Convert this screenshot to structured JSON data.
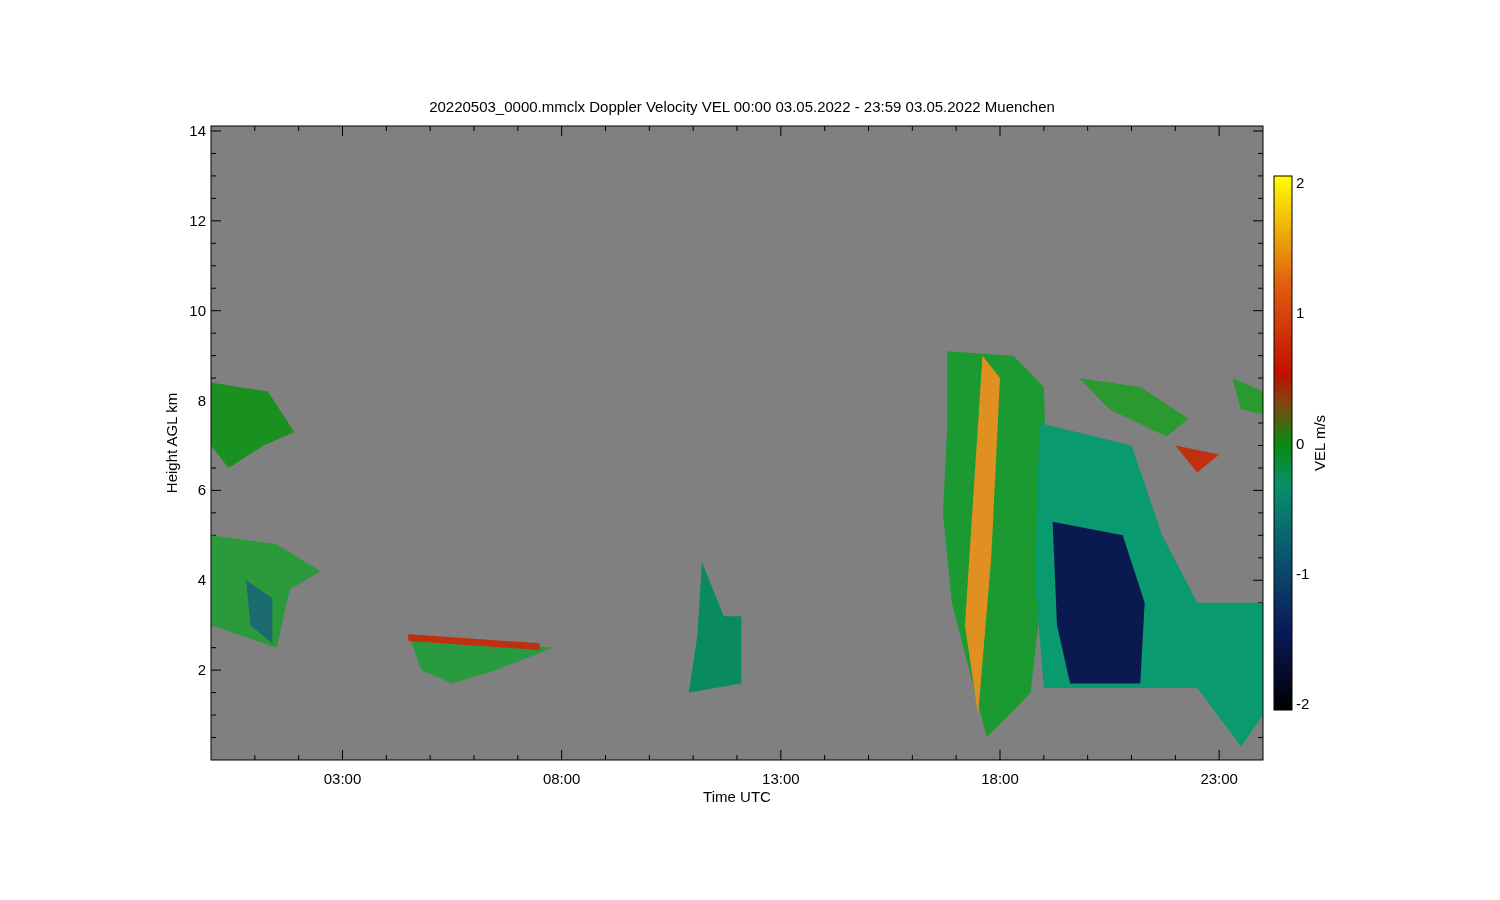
{
  "title": "20220503_0000.mmclx Doppler Velocity VEL   00:00 03.05.2022 - 23:59 03.05.2022 Muenchen",
  "y_axis": {
    "label": "Height AGL km",
    "ticks": [
      "14",
      "12",
      "10",
      "8",
      "6",
      "4",
      "2"
    ]
  },
  "x_axis": {
    "label": "Time UTC",
    "ticks": [
      "03:00",
      "08:00",
      "13:00",
      "18:00",
      "23:00"
    ]
  },
  "colorbar": {
    "label": "VEL m/s",
    "ticks": [
      "2",
      "1",
      "0",
      "-1",
      "-2"
    ]
  }
}
